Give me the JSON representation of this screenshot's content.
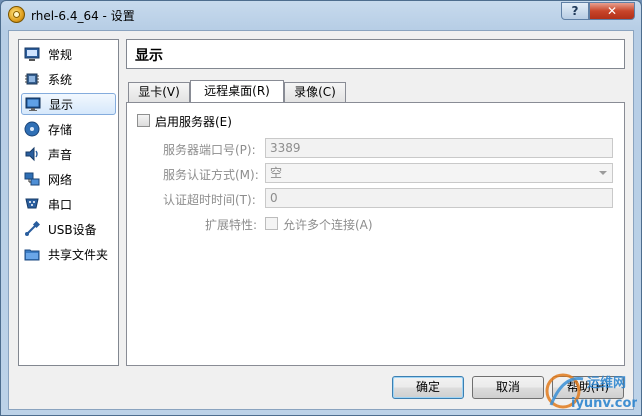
{
  "window": {
    "title": "rhel-6.4_64 - 设置",
    "help_glyph": "?",
    "close_glyph": "✕"
  },
  "sidebar": {
    "items": [
      {
        "label": "常规",
        "icon": "general-icon"
      },
      {
        "label": "系统",
        "icon": "system-chip-icon"
      },
      {
        "label": "显示",
        "icon": "display-monitor-icon"
      },
      {
        "label": "存储",
        "icon": "storage-disk-icon"
      },
      {
        "label": "声音",
        "icon": "speaker-icon"
      },
      {
        "label": "网络",
        "icon": "network-icon"
      },
      {
        "label": "串口",
        "icon": "serial-port-icon"
      },
      {
        "label": "USB设备",
        "icon": "usb-icon"
      },
      {
        "label": "共享文件夹",
        "icon": "shared-folder-icon"
      }
    ],
    "selected_index": 2
  },
  "header": {
    "title": "显示"
  },
  "tabs": [
    {
      "label": "显卡(V)"
    },
    {
      "label": "远程桌面(R)"
    },
    {
      "label": "录像(C)"
    }
  ],
  "remote_desktop": {
    "enable_server_label": "启用服务器(E)",
    "port_label": "服务器端口号(P):",
    "port_value": "3389",
    "auth_method_label": "服务认证方式(M):",
    "auth_method_value": "空",
    "auth_timeout_label": "认证超时时间(T):",
    "auth_timeout_value": "0",
    "extended_features_label": "扩展特性:",
    "allow_multiple_label": "允许多个连接(A)"
  },
  "buttons": {
    "ok": "确定",
    "cancel": "取消",
    "help": "帮助(H)"
  },
  "watermark": {
    "line1": "运维网",
    "line2": "iyunv.com"
  },
  "colors": {
    "selected_bg": "#d6e8fb",
    "selected_border": "#84acdd",
    "disabled_text": "#8d8d8d",
    "default_button_border": "#3c7fb1"
  }
}
